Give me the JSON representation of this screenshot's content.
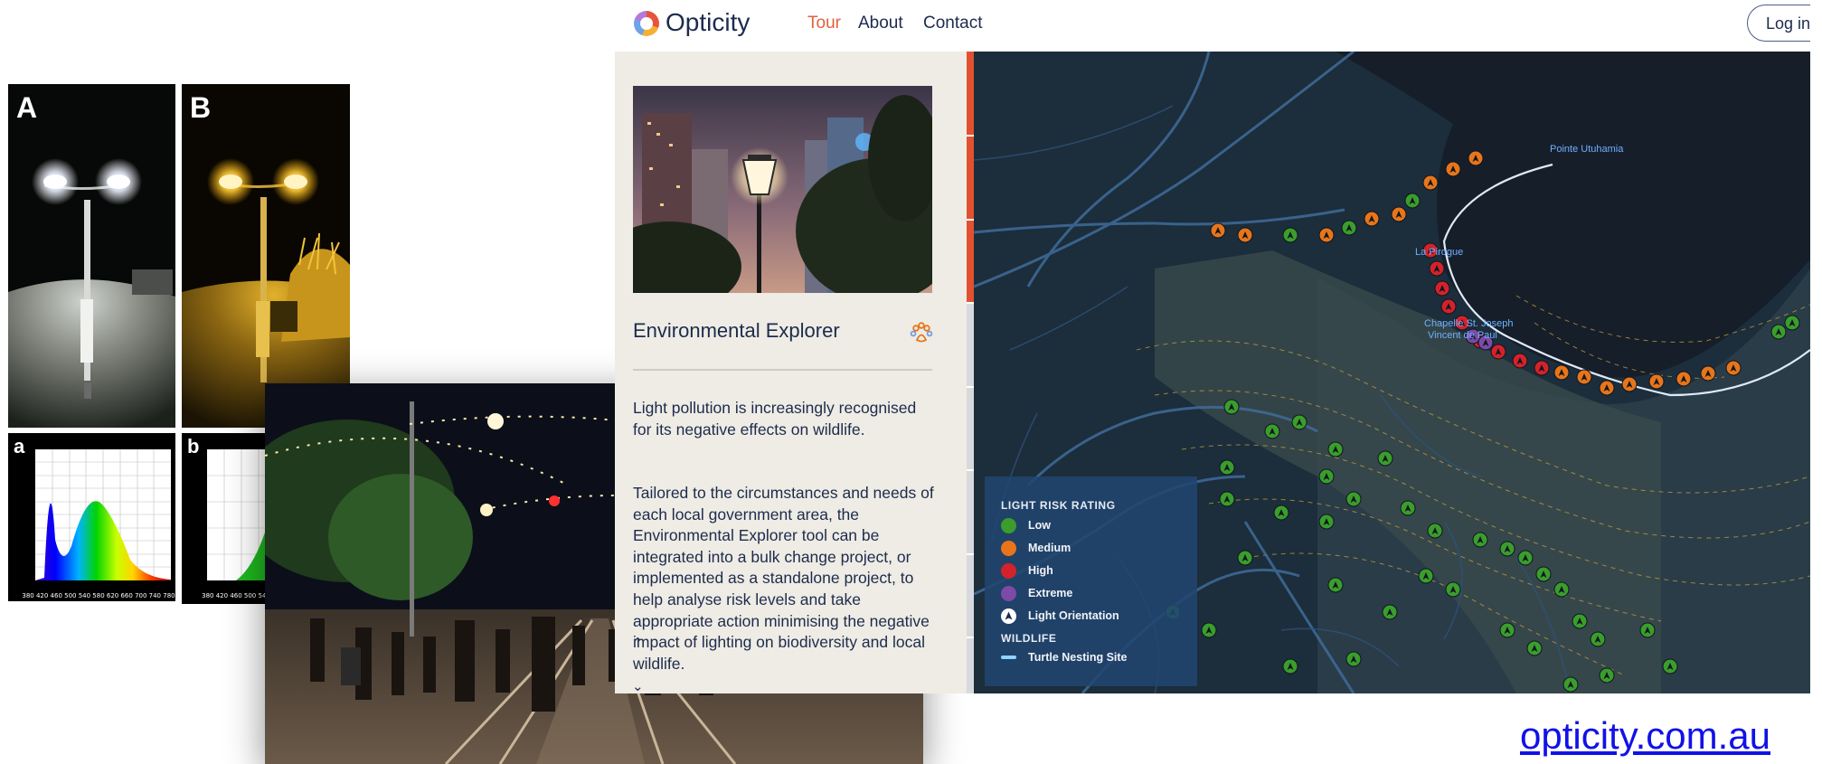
{
  "figure_labels": {
    "photo_a": "A",
    "photo_b": "B",
    "spectrum_a": "a",
    "spectrum_b": "b"
  },
  "app": {
    "logo": "Opticity",
    "nav": [
      {
        "label": "Tour",
        "active": true
      },
      {
        "label": "About",
        "active": false
      },
      {
        "label": "Contact",
        "active": false
      }
    ],
    "login_label": "Log in"
  },
  "panel": {
    "title": "Environmental Explorer",
    "icon": "paw-icon",
    "paragraphs": [
      "Light pollution is increasingly recognised for its negative effects on wildlife.",
      "Tailored to the circumstances and needs of each local government area, the Environmental Explorer tool can be integrated into a bulk change project, or implemented as a standalone project, to help analyse risk levels and take appropriate action minimising the negative impact of lighting on biodiversity and local wildlife."
    ],
    "scroll_up": "⌃",
    "scroll_down": "⌄"
  },
  "map": {
    "places": [
      "Pointe Utuhamia",
      "La Pirogue",
      "Chapelle St. Joseph",
      "Vincent de Paul"
    ],
    "legend": {
      "risk_heading": "LIGHT RISK RATING",
      "risk_items": [
        {
          "label": "Low",
          "color": "#3a9d2c"
        },
        {
          "label": "Medium",
          "color": "#e8751a"
        },
        {
          "label": "High",
          "color": "#d4222b"
        },
        {
          "label": "Extreme",
          "color": "#7d4aa8"
        }
      ],
      "orientation_label": "Light Orientation",
      "wildlife_heading": "WILDLIFE",
      "wildlife_items": [
        {
          "label": "Turtle Nesting Site",
          "color": "#8fd4ff"
        }
      ]
    }
  },
  "footer_link": "opticity.com.au"
}
